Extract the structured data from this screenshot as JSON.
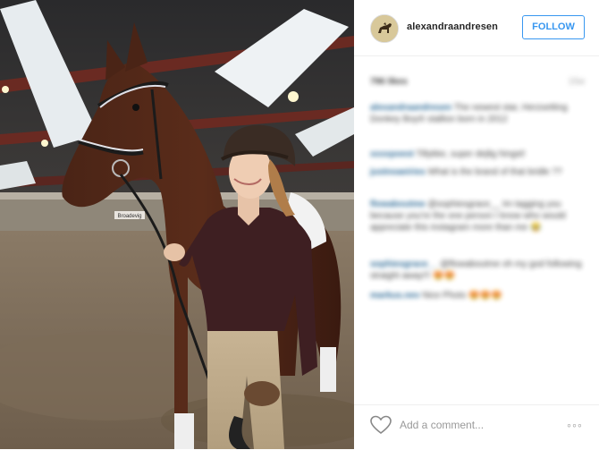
{
  "post": {
    "username": "alexandraandresen",
    "follow_label": "FOLLOW",
    "likes": "796 likes",
    "time": "15w",
    "comments": [
      {
        "user": "alexandraandresen",
        "text": "The newest star, Herzsetting Donkey Boy® stallion born in 2012"
      },
      {
        "user": "xxxxpoest",
        "text": "Tillykke, super dejlig hingst!"
      },
      {
        "user": "justnoaeiries",
        "text": "What is the brand of that bridle ??"
      },
      {
        "user": "flowaboutme",
        "text": "@sophiesgrace__ Im tagging you because you're the one person I know who would appreciate this instagram more than me 😂"
      },
      {
        "user": "sophiesgrace__",
        "text": "@flowaboutme oh my god following straight away!!! 😍😍"
      },
      {
        "user": "markus.nev",
        "text": "Nice Photo 😍😍😍"
      }
    ],
    "add_comment_placeholder": "Add a comment...",
    "more_label": "◦◦◦"
  },
  "photo": {
    "arena_sign": "Broadevig"
  },
  "icons": {
    "heart": "heart-icon",
    "more": "more-options-icon",
    "avatar": "avatar-horse-logo"
  }
}
